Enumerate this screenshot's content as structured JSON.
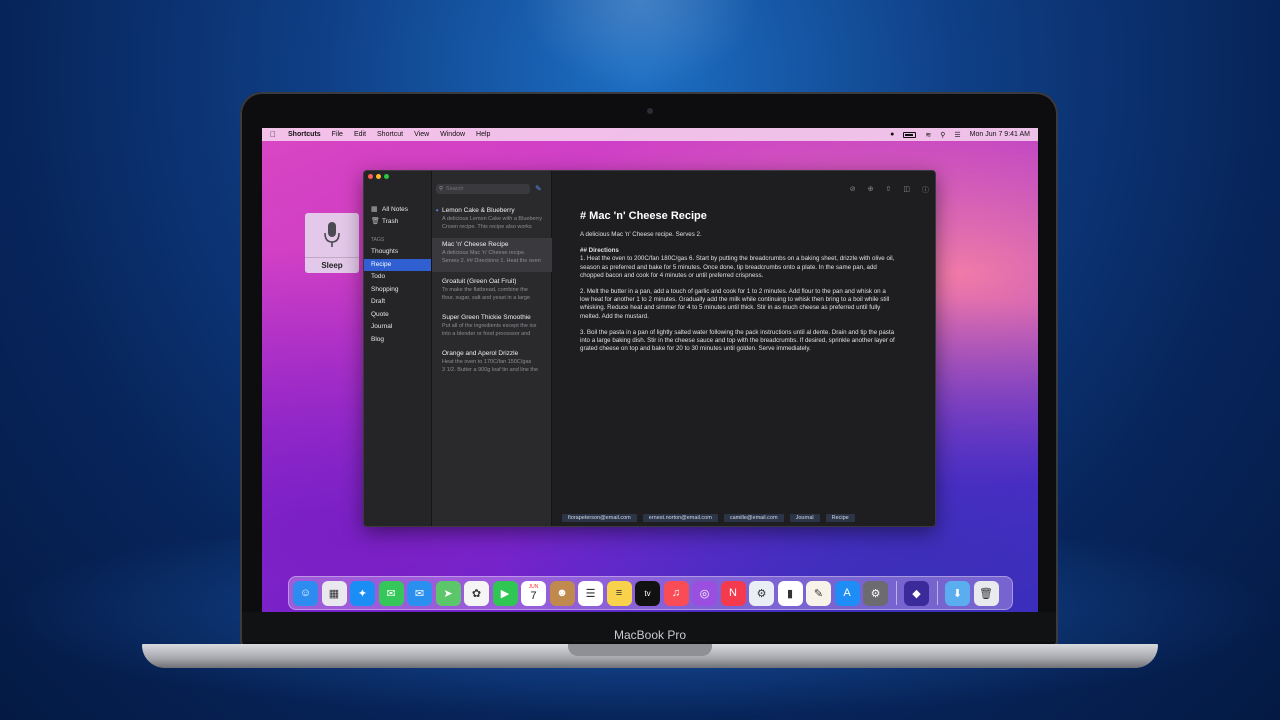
{
  "device": {
    "label": "MacBook Pro"
  },
  "menubar": {
    "app": "Shortcuts",
    "items": [
      "File",
      "Edit",
      "Shortcut",
      "View",
      "Window",
      "Help"
    ],
    "datetime": "Mon Jun 7  9:41 AM"
  },
  "siri": {
    "label": "Sleep"
  },
  "sidebar": {
    "items": [
      {
        "label": "All Notes",
        "icon": "notes-icon"
      },
      {
        "label": "Trash",
        "icon": "trash-icon"
      }
    ],
    "tags_header": "TAGS",
    "tags": [
      "Thoughts",
      "Recipe",
      "Todo",
      "Shopping",
      "Draft",
      "Quote",
      "Journal",
      "Blog"
    ],
    "active_tag": "Recipe"
  },
  "notelist": {
    "search_placeholder": "Search",
    "notes": [
      {
        "title": "Lemon Cake & Blueberry",
        "preview1": "A delicious Lemon Cake with a Blueberry",
        "preview2": "Crown recipe. This recipe also works"
      },
      {
        "title": "Mac 'n' Cheese Recipe",
        "preview1": "A delicious Mac 'n' Cheese recipe.",
        "preview2": "Serves 2. ## Directions 1. Heat the oven"
      },
      {
        "title": "Groatuit (Green Oat Fruit)",
        "preview1": "To make the flatbread, combine the",
        "preview2": "flour, sugar, salt and yeast in a large"
      },
      {
        "title": "Super Green Thickie Smoothie",
        "preview1": "Put all of the ingredients except the ice",
        "preview2": "into a blender or food processor and"
      },
      {
        "title": "Orange and Aperol Drizzle",
        "preview1": "Heat the oven to 170C/fan 150C/gas",
        "preview2": "3 1/2. Butter a 900g loaf tin and line the"
      }
    ]
  },
  "editor": {
    "title": "# Mac 'n' Cheese Recipe",
    "intro": "A delicious Mac 'n' Cheese recipe. Serves 2.",
    "directions_heading": "## Directions",
    "step1": "1. Heat the oven to 200C/fan 180C/gas 6. Start by putting the breadcrumbs on a baking sheet, drizzle with olive oil, season as preferred and bake for 5 minutes. Once done, tip breadcrumbs onto a plate. In the same pan, add chopped bacon and cook for 4 minutes or until preferred crispness.",
    "step2": "2. Melt the butter in a pan, add a touch of garlic and cook for 1 to 2 minutes. Add flour to the pan and whisk on a low heat for another 1 to 2 minutes. Gradually add the milk while continuing to whisk then bring to a boil while still whisking. Reduce heat and simmer for 4 to 5 minutes until thick. Stir in as much cheese as preferred until fully melted. Add the mustard.",
    "step3": "3. Boil the pasta in a pan of lightly salted water following the pack instructions until al dente. Drain and tip the pasta into a large baking dish. Stir in the cheese sauce and top with the breadcrumbs. If desired, sprinkle another layer of grated cheese on top and bake for 20 to 30 minutes until golden. Serve immediately.",
    "tags": [
      "fiorapeterson@email.com",
      "ernest.norton@email.com",
      "camille@email.com",
      "Journal",
      "Recipe"
    ]
  },
  "dock": {
    "apps": [
      {
        "name": "finder-icon",
        "color": "#2e8cf0"
      },
      {
        "name": "launchpad-icon",
        "color": "#e8e8ee"
      },
      {
        "name": "safari-icon",
        "color": "#1a8ef5"
      },
      {
        "name": "messages-icon",
        "color": "#35c759"
      },
      {
        "name": "mail-icon",
        "color": "#2b8ff0"
      },
      {
        "name": "maps-icon",
        "color": "#5cc66a"
      },
      {
        "name": "photos-icon",
        "color": "#f5f5f5"
      },
      {
        "name": "facetime-icon",
        "color": "#2fc654"
      },
      {
        "name": "calendar-icon",
        "color": "#ffffff"
      },
      {
        "name": "contacts-icon",
        "color": "#c08a4e"
      },
      {
        "name": "reminders-icon",
        "color": "#ffffff"
      },
      {
        "name": "notes-app-icon",
        "color": "#f7d24a"
      },
      {
        "name": "appletv-icon",
        "color": "#111111"
      },
      {
        "name": "music-icon",
        "color": "#f94c57"
      },
      {
        "name": "podcasts-icon",
        "color": "#9b4fe0"
      },
      {
        "name": "news-icon",
        "color": "#f53a4d"
      },
      {
        "name": "configurator-icon",
        "color": "#e9eef6"
      },
      {
        "name": "numbers-icon",
        "color": "#ffffff"
      },
      {
        "name": "pages-icon",
        "color": "#f7f3e9"
      },
      {
        "name": "appstore-icon",
        "color": "#1e8df5"
      },
      {
        "name": "system-preferences-icon",
        "color": "#6b6b70"
      },
      {
        "name": "shortcuts-icon",
        "color": "#3a2a9a"
      },
      {
        "name": "downloads-icon",
        "color": "#5aaef0"
      },
      {
        "name": "trash-dock-icon",
        "color": "#e8eaee"
      }
    ],
    "calendar_month": "JUN",
    "calendar_day": "7"
  }
}
